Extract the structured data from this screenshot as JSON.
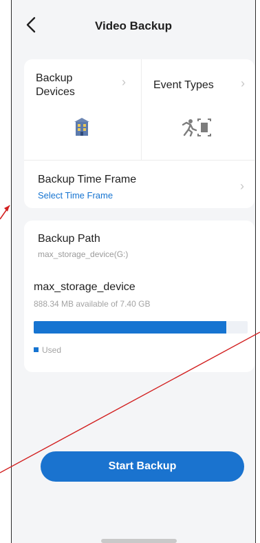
{
  "header": {
    "title": "Video Backup",
    "back_icon": "chevron-left-icon"
  },
  "tiles": {
    "backup_devices": {
      "label": "Backup Devices",
      "icon": "building-icon"
    },
    "event_types": {
      "label": "Event Types",
      "icon": "motion-icon"
    }
  },
  "time_frame": {
    "title": "Backup Time Frame",
    "subtitle": "Select Time Frame"
  },
  "backup_path": {
    "title": "Backup Path",
    "path": "max_storage_device(G:)",
    "device_name": "max_storage_device",
    "availability": "888.34 MB available of 7.40 GB",
    "used_fraction": 0.9,
    "legend_label": "Used"
  },
  "actions": {
    "start_label": "Start Backup"
  },
  "colors": {
    "accent": "#1674d1",
    "button": "#1a73cf",
    "background": "#f4f5f7",
    "annotation_arrow": "#d21f1f"
  }
}
